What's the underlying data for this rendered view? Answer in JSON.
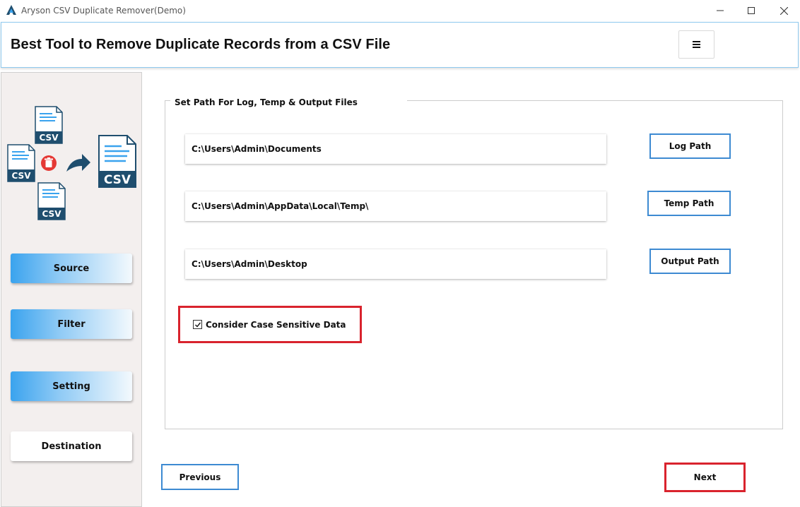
{
  "window": {
    "title": "Aryson CSV Duplicate Remover(Demo)",
    "controls": {
      "minimize": "minimize-icon",
      "maximize": "maximize-icon",
      "close": "close-icon"
    }
  },
  "header": {
    "heading": "Best Tool to Remove Duplicate Records from a CSV File",
    "menu_icon": "hamburger-menu-icon"
  },
  "sidebar": {
    "logo_icon": "csv-duplicate-remover-logo",
    "logo_texts": [
      "CSV",
      "CSV",
      "CSV",
      "CSV"
    ],
    "items": [
      {
        "label": "Source",
        "state": "visited"
      },
      {
        "label": "Filter",
        "state": "visited"
      },
      {
        "label": "Setting",
        "state": "active"
      },
      {
        "label": "Destination",
        "state": "pending"
      }
    ]
  },
  "main": {
    "section_title": "Set Path For Log, Temp & Output Files",
    "paths": [
      {
        "value": "C:\\Users\\Admin\\Documents",
        "button": "Log Path"
      },
      {
        "value": "C:\\Users\\Admin\\AppData\\Local\\Temp\\",
        "button": "Temp Path"
      },
      {
        "value": "C:\\Users\\Admin\\Desktop",
        "button": "Output Path"
      }
    ],
    "case_sensitive": {
      "label": "Consider Case Sensitive Data",
      "checked": true
    }
  },
  "footer": {
    "previous_label": "Previous",
    "next_label": "Next"
  },
  "colors": {
    "accent_blue": "#3d8ad2",
    "highlight_red": "#d9232d",
    "nav_gradient_start": "#3aa3ee",
    "sidebar_bg": "#f3efee",
    "logo_dark": "#1f4e6e",
    "delete_red": "#e53935"
  }
}
